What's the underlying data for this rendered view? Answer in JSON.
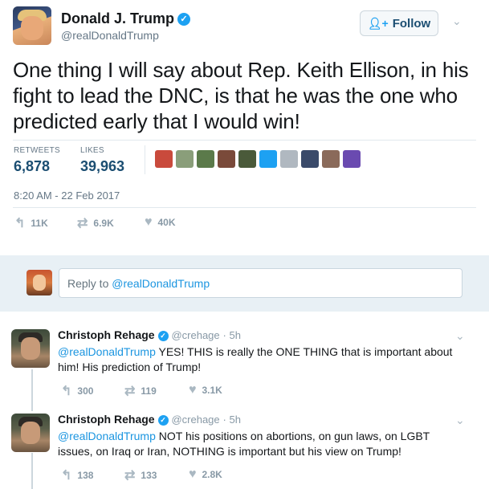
{
  "tweet": {
    "author_name": "Donald J. Trump",
    "handle": "@realDonaldTrump",
    "follow_label": "Follow",
    "text": "One thing I will say about Rep. Keith Ellison, in his fight to lead the DNC, is that he was the one who predicted early that I would win!",
    "retweets_label": "RETWEETS",
    "retweets_count": "6,878",
    "likes_label": "LIKES",
    "likes_count": "39,963",
    "timestamp": "8:20 AM - 22 Feb 2017",
    "actions": {
      "reply": "11K",
      "retweet": "6.9K",
      "like": "40K"
    },
    "liker_colors": [
      "#c94a3c",
      "#8a9e7a",
      "#5b7a4a",
      "#7a4a3a",
      "#4a5a3a",
      "#1da1f2",
      "#b0b8c0",
      "#3a4a6a",
      "#8a6a5a",
      "#6a4ab0"
    ]
  },
  "reply_box": {
    "prefix": "Reply to ",
    "mention": "@realDonaldTrump"
  },
  "replies": [
    {
      "name": "Christoph Rehage",
      "handle": "@crehage",
      "time": "· 5h",
      "mention": "@realDonaldTrump",
      "text": " YES! THIS is really the ONE THING that is important about him! His prediction of Trump!",
      "actions": {
        "reply": "300",
        "retweet": "119",
        "like": "3.1K"
      }
    },
    {
      "name": "Christoph Rehage",
      "handle": "@crehage",
      "time": "· 5h",
      "mention": "@realDonaldTrump",
      "text": " NOT his positions on abortions, on gun laws, on LGBT issues, on Iraq or Iran, NOTHING is important but his view on Trump!",
      "actions": {
        "reply": "138",
        "retweet": "133",
        "like": "2.8K"
      }
    }
  ],
  "icons": {
    "verified": "✓",
    "chevron": "⌄",
    "follow": "+",
    "reply": "↰",
    "retweet": "⇄",
    "like": "♥"
  }
}
